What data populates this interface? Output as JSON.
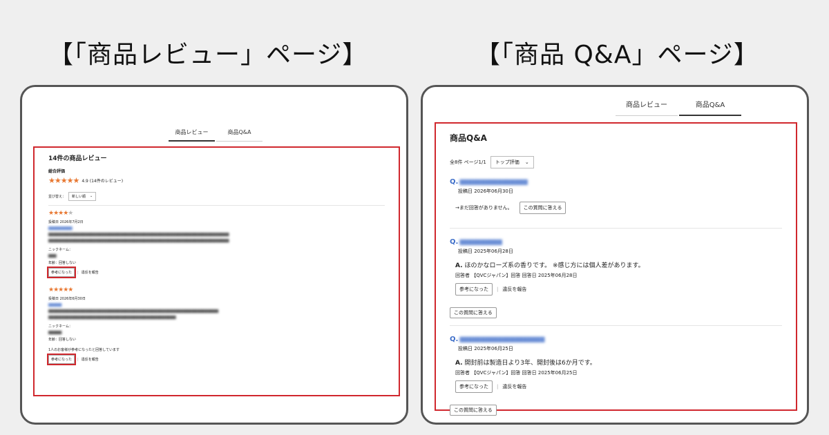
{
  "headings": {
    "left": "【「商品レビュー」ページ】",
    "right": "【「商品 Q&A」ページ】"
  },
  "tabs": {
    "review": "商品レビュー",
    "qa": "商品Q&A"
  },
  "review_page": {
    "title": "14件の商品レビュー",
    "overall_label": "総合評価",
    "overall_stars": 5,
    "overall_score_text": "4.9 (14件のレビュー)",
    "sort_label": "並び替え：",
    "sort_value": "新しい順",
    "reviews": [
      {
        "stars_filled": 4,
        "date": "投稿日 2026年7月2日",
        "nickname_label": "ニックネーム：",
        "age_label": "年齢：回答しない",
        "helpful_note": "",
        "helpful_button": "参考になった",
        "report_link": "違反を報告"
      },
      {
        "stars_filled": 5,
        "date": "投稿日 2026年6月30日",
        "nickname_label": "ニックネーム：",
        "age_label": "年齢：回答しない",
        "helpful_note": "1人のお客様が参考になったと回答しています",
        "helpful_button": "参考になった",
        "report_link": "違反を報告"
      }
    ]
  },
  "qa_page": {
    "title": "商品Q&A",
    "count_text": "全8件 ページ1/1",
    "sort_value": "トップ評価",
    "answer_button": "この質問に答える",
    "helpful_button": "参考になった",
    "report_link": "違反を報告",
    "questions": [
      {
        "q_mark": "Q.",
        "date": "投稿日 2026年06月30日",
        "no_answer": "→まだ回答がありません。"
      },
      {
        "q_mark": "Q.",
        "date": "投稿日 2025年06月28日",
        "answer_mark": "A.",
        "answer": "ほのかなローズ系の香りです。 ※感じ方には個人差があります。",
        "answer_meta": "回答者 【QVCジャパン】回答 回答日 2025年06月28日"
      },
      {
        "q_mark": "Q.",
        "date": "投稿日 2025年06月25日",
        "answer_mark": "A.",
        "answer": "開封前は製造日より3年、開封後は6か月です。",
        "answer_meta": "回答者 【QVCジャパン】回答 回答日 2025年06月25日"
      }
    ]
  },
  "colors": {
    "highlight_red": "#d0272d",
    "star_orange": "#e87832",
    "link_blue": "#3b6cc8"
  }
}
